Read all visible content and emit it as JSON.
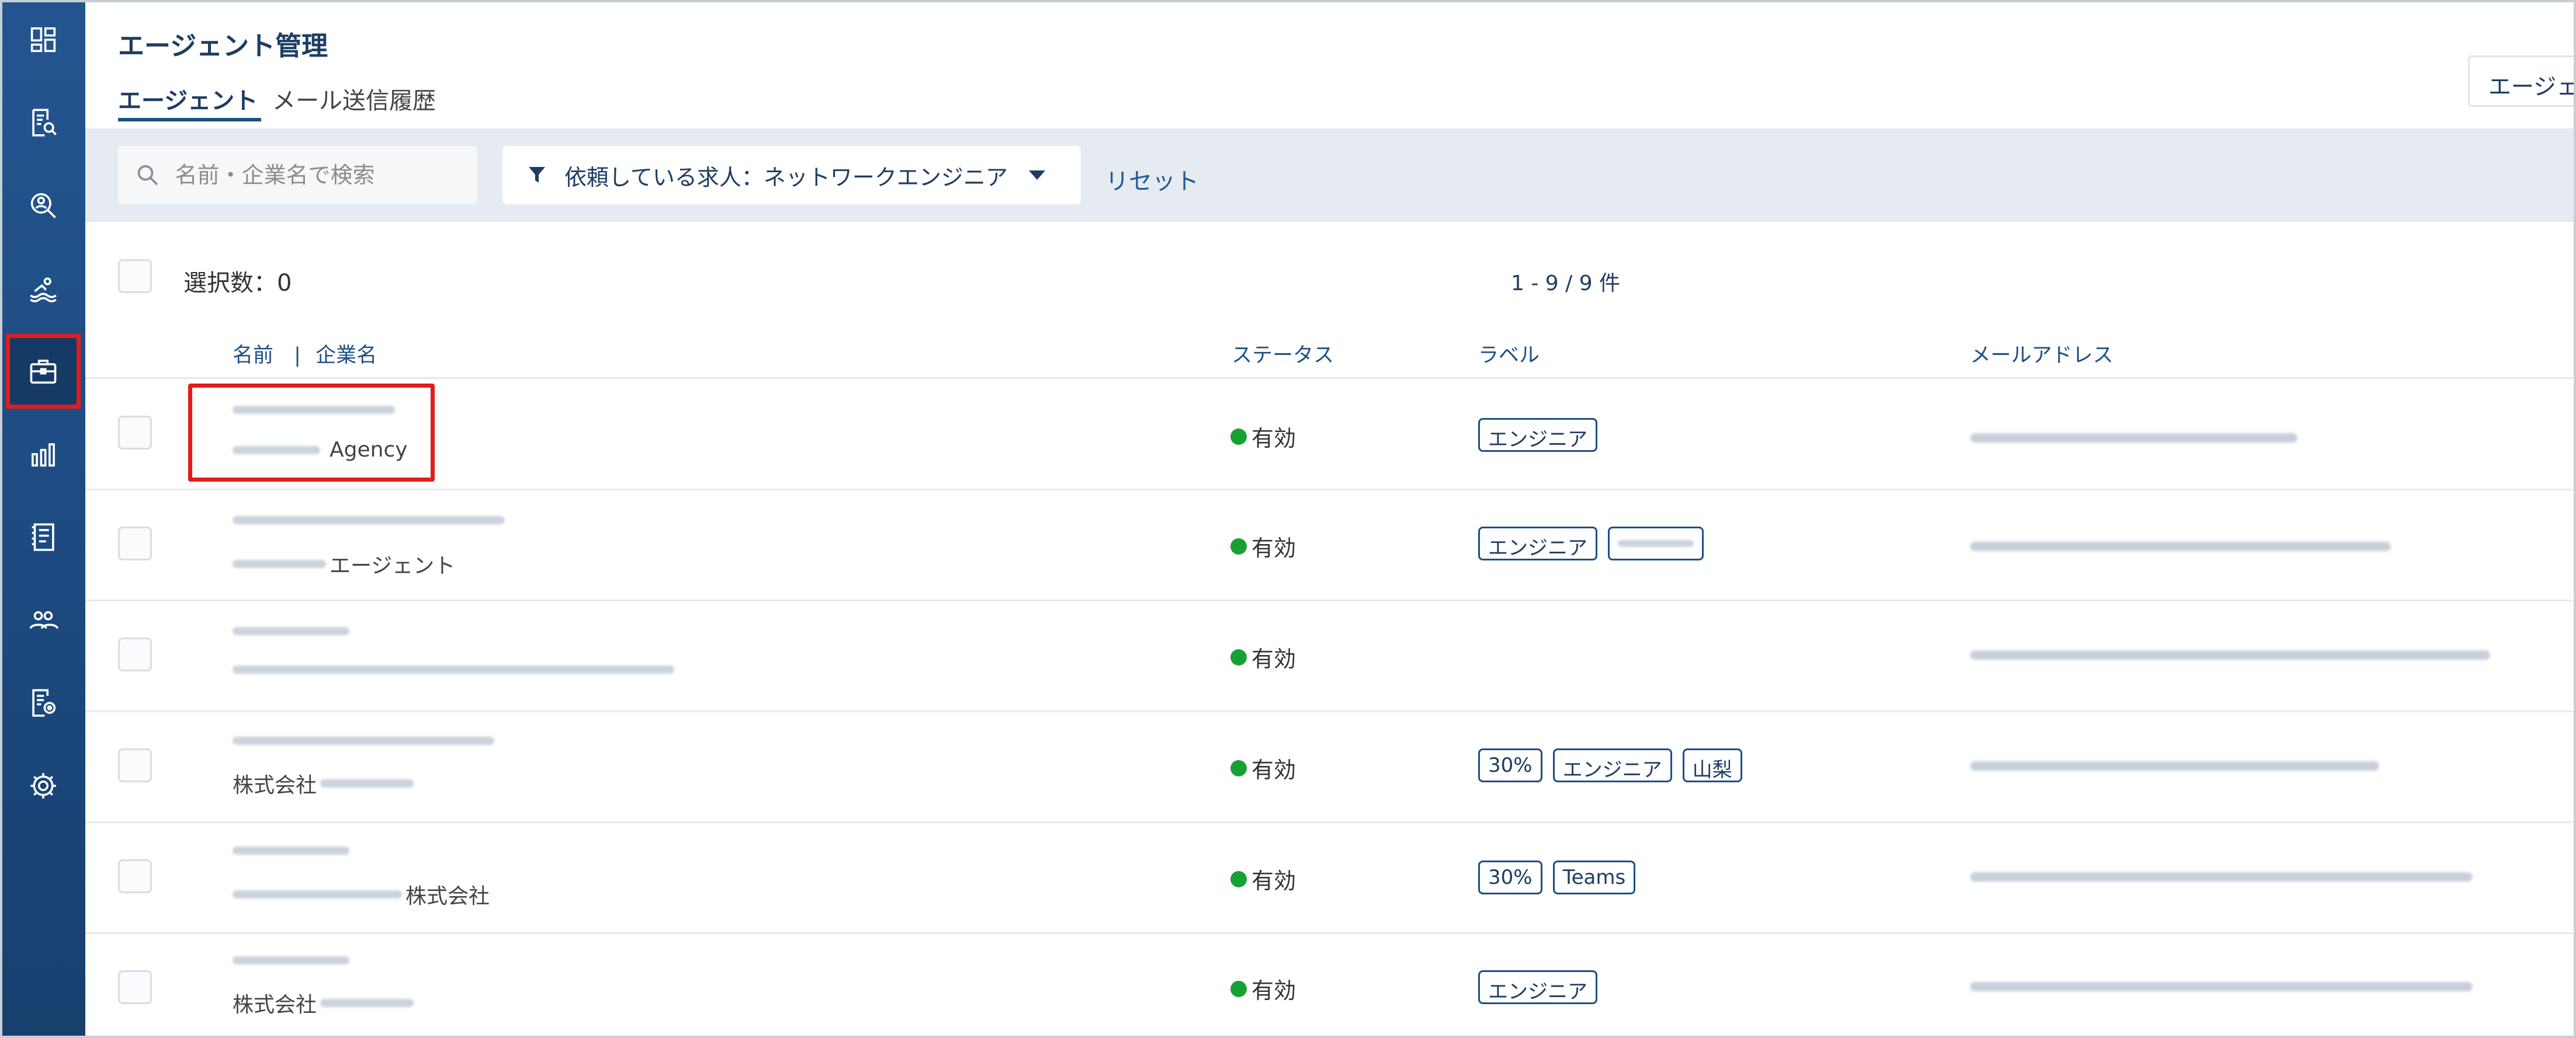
{
  "header": {
    "title": "エージェント管理",
    "tabs": [
      {
        "label": "エージェント",
        "active": true
      },
      {
        "label": "メール送信履歴",
        "active": false
      }
    ],
    "top_right_button": "エージェ"
  },
  "sidebar": {
    "items": [
      {
        "icon": "dashboard-icon"
      },
      {
        "icon": "document-search-icon"
      },
      {
        "icon": "person-search-icon"
      },
      {
        "icon": "swimmer-icon"
      },
      {
        "icon": "briefcase-icon",
        "active": true
      },
      {
        "icon": "bar-chart-icon"
      },
      {
        "icon": "book-icon"
      },
      {
        "icon": "users-icon"
      },
      {
        "icon": "document-settings-icon"
      },
      {
        "icon": "gear-icon"
      }
    ]
  },
  "filters": {
    "search_placeholder": "名前・企業名で検索",
    "job_filter": "依頼している求人：ネットワークエンジニア",
    "reset": "リセット"
  },
  "list": {
    "selected_count": "選択数：0",
    "pagination": "1 - 9 / 9 件",
    "columns": {
      "name": "名前",
      "separator": "|",
      "company": "企業名",
      "status": "ステータス",
      "labels": "ラベル",
      "email": "メールアドレス"
    },
    "rows": [
      {
        "company_suffix": "Agency",
        "company_prefix": "",
        "status": "有効",
        "labels": [
          "エンジニア"
        ]
      },
      {
        "company_suffix": "エージェント",
        "company_prefix": "",
        "status": "有効",
        "labels": [
          "エンジニア"
        ]
      },
      {
        "company_suffix": "",
        "company_prefix": "",
        "status": "有効",
        "labels": []
      },
      {
        "company_suffix": "",
        "company_prefix": "株式会社",
        "status": "有効",
        "labels": [
          "30%",
          "エンジニア",
          "山梨"
        ]
      },
      {
        "company_suffix": "株式会社",
        "company_prefix": "",
        "status": "有効",
        "labels": [
          "30%",
          "Teams"
        ]
      },
      {
        "company_suffix": "",
        "company_prefix": "株式会社",
        "status": "有効",
        "labels": [
          "エンジニア"
        ]
      }
    ]
  },
  "colors": {
    "sidebar": "#1f4f86",
    "accent": "#1d3d63",
    "status_active": "#17a133",
    "highlight": "#e21c1c"
  }
}
